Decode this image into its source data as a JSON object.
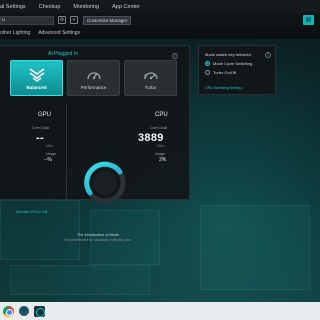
{
  "nav": {
    "items": [
      {
        "label": "al Settings"
      },
      {
        "label": "Checkup"
      },
      {
        "label": "Monitoring"
      },
      {
        "label": "App Center"
      }
    ]
  },
  "toolbar": {
    "profile_value": "u",
    "button_label": "Customize Manager"
  },
  "subtabs": {
    "items": [
      {
        "label": "other Lighting"
      },
      {
        "label": "Advanced Settings"
      }
    ]
  },
  "modes": {
    "header": "AI Plugged In",
    "items": [
      {
        "label": "Balanced",
        "selected": true
      },
      {
        "label": "Performance",
        "selected": false
      },
      {
        "label": "Turbo",
        "selected": false
      }
    ]
  },
  "gpu": {
    "title": "GPU",
    "core_clock_label": "Core Clock",
    "core_clock_value": "--",
    "core_clock_unit": "MHz",
    "usage_label": "Usage",
    "usage_value": "--%",
    "discrete_link": "Discrete GPU in ON"
  },
  "cpu": {
    "title": "CPU",
    "core_clock_label": "Core Clock",
    "core_clock_value": "3889",
    "core_clock_unit": "MHz",
    "usage_label": "Usage",
    "usage_value": "2%"
  },
  "intro": {
    "title": "The introduction of Mode",
    "description": "Recommended for standard, everyday use."
  },
  "switch_panel": {
    "title": "Mode switch key behavior",
    "options": [
      {
        "label": "Mode Cycle Switching",
        "selected": true
      },
      {
        "label": "Turbo On/Off",
        "selected": false
      }
    ],
    "link": "GPU Operating Setting >"
  },
  "colors": {
    "accent": "#1fc9c9",
    "panel_bg": "#121618",
    "selected_mode": "#14b3b5"
  },
  "icons": {
    "balanced": "balanced-chevron-icon",
    "performance": "speedometer-icon",
    "turbo": "turbo-speedometer-icon"
  }
}
